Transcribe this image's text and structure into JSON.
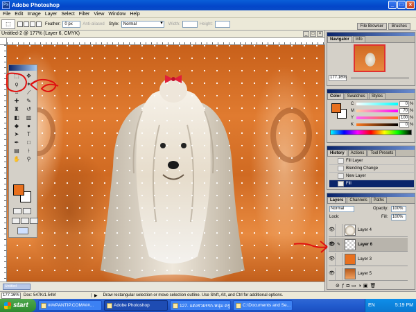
{
  "window": {
    "title": "Adobe Photoshop",
    "controls": [
      "_",
      "□",
      "×"
    ]
  },
  "menu": [
    "File",
    "Edit",
    "Image",
    "Layer",
    "Select",
    "Filter",
    "View",
    "Window",
    "Help"
  ],
  "options": {
    "feather_label": "Feather:",
    "feather_value": "0 px",
    "antialiased": "Anti-aliased",
    "style_label": "Style:",
    "style_value": "Normal",
    "width_label": "Width:",
    "height_label": "Height:",
    "tabs": [
      "File Browser",
      "Brushes"
    ]
  },
  "document": {
    "title": "Untitled-2 @ 177% (Layer 6, CMYK)"
  },
  "navigator": {
    "tabs": [
      "Navigator",
      "Info"
    ],
    "zoom": "177.16%"
  },
  "color_panel": {
    "tabs": [
      "Color",
      "Swatches",
      "Styles"
    ],
    "channels": [
      {
        "label": "C",
        "value": "0",
        "color": "#00ffff"
      },
      {
        "label": "M",
        "value": "70",
        "color": "#ff00ff"
      },
      {
        "label": "Y",
        "value": "100",
        "color": "#ffff00"
      },
      {
        "label": "K",
        "value": "0",
        "color": "#000000"
      }
    ],
    "pct": "%",
    "foreground": "#e8701e"
  },
  "history_panel": {
    "tabs": [
      "History",
      "Actions",
      "Tool Presets"
    ],
    "items": [
      "Fill Layer",
      "Blending Change",
      "New Layer",
      "Fill"
    ],
    "selected_index": 3
  },
  "layers_panel": {
    "tabs": [
      "Layers",
      "Channels",
      "Paths"
    ],
    "blend_mode": "Normal",
    "opacity_label": "Opacity:",
    "opacity": "100%",
    "lock_label": "Lock:",
    "fill_label": "Fill:",
    "fill": "100%",
    "layers": [
      {
        "name": "Layer 4",
        "thumb": "dog"
      },
      {
        "name": "Layer 6",
        "thumb": "transparent",
        "selected": true
      },
      {
        "name": "Layer 3",
        "thumb": "orange"
      },
      {
        "name": "Layer 5",
        "thumb": "photo"
      }
    ]
  },
  "statusbar": {
    "zoom": "177.16%",
    "doc": "Doc: 547K/1.54M",
    "message": "Draw rectangular selection or move selection outline. Use Shift, Alt, and Ctrl for additional options."
  },
  "taskbar": {
    "start": "start",
    "buttons": [
      {
        "label": "###PANTIP.COM###...",
        "active": false
      },
      {
        "label": "Adobe Photoshop",
        "active": true
      },
      {
        "label": "127. แต่งรวยรรก-หนุ่ม ครู...",
        "active": false
      },
      {
        "label": "C:\\Documents and Se...",
        "active": false
      }
    ],
    "lang": "EN",
    "time": "5:19 PM"
  },
  "icons": {
    "app": "photoshop-icon",
    "marquee": "rectangular-marquee-icon"
  }
}
